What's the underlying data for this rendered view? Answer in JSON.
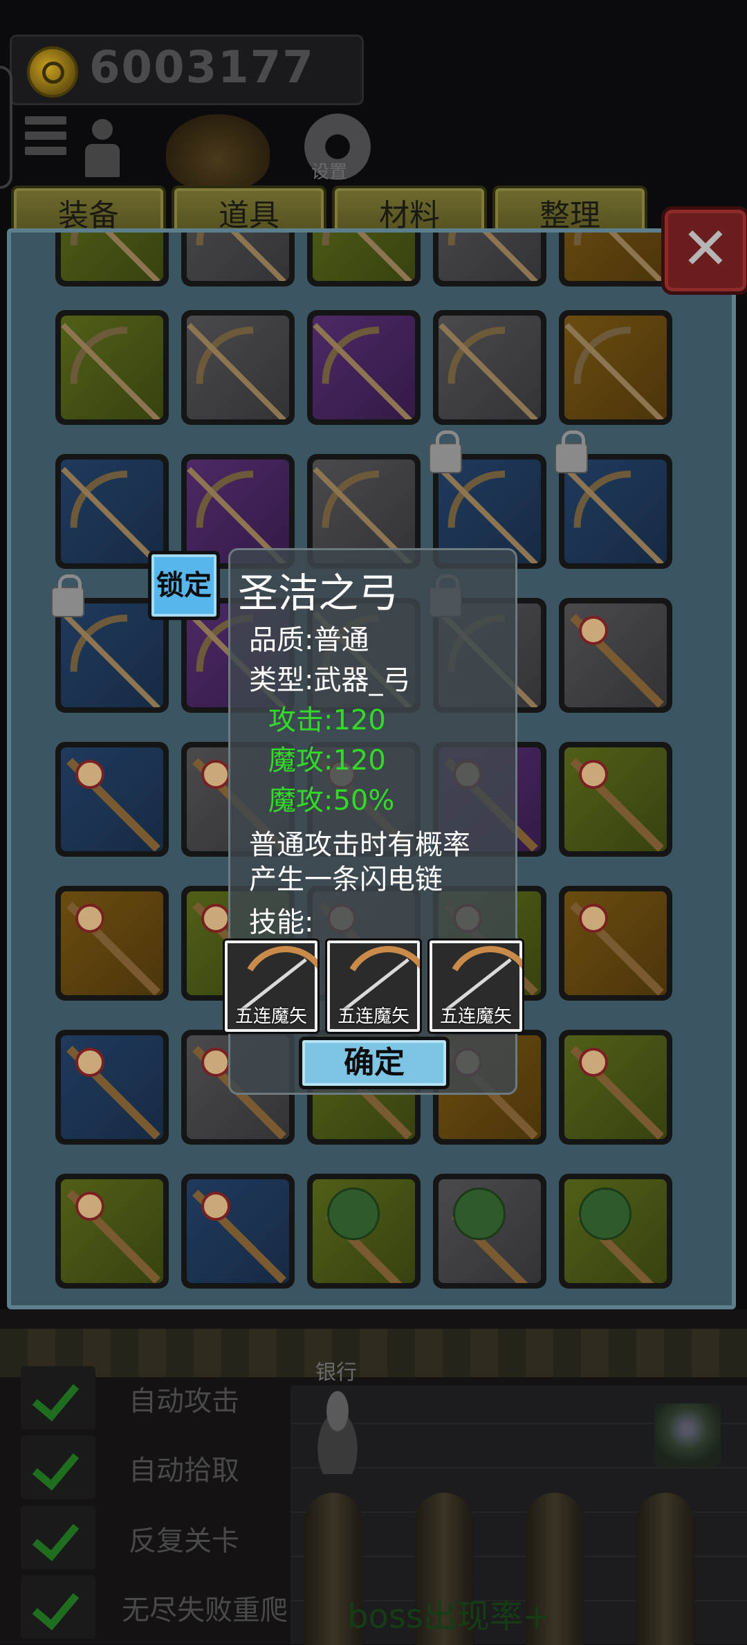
{
  "hud": {
    "gold": "6003177",
    "settings_label": "设置",
    "icons": [
      "coin-icon",
      "menu-icon",
      "pawn-icon",
      "bag-icon",
      "gear-icon"
    ]
  },
  "tabs": [
    "装备",
    "道具",
    "材料",
    "整理"
  ],
  "close_symbol": "✕",
  "inventory": {
    "rows": [
      [
        {
          "weapon": "bow",
          "quality": "green"
        },
        {
          "weapon": "bow",
          "quality": "gray"
        },
        {
          "weapon": "bow",
          "quality": "green"
        },
        {
          "weapon": "bow",
          "quality": "gray"
        },
        {
          "weapon": "bow",
          "quality": "orange"
        }
      ],
      [
        {
          "weapon": "bow",
          "quality": "green"
        },
        {
          "weapon": "bow",
          "quality": "gray"
        },
        {
          "weapon": "bow",
          "quality": "purple"
        },
        {
          "weapon": "bow",
          "quality": "gray"
        },
        {
          "weapon": "bow",
          "quality": "orange"
        }
      ],
      [
        {
          "weapon": "bow",
          "quality": "blue"
        },
        {
          "weapon": "bow",
          "quality": "purple"
        },
        {
          "weapon": "bow",
          "quality": "gray"
        },
        {
          "weapon": "bow",
          "quality": "blue",
          "locked": true
        },
        {
          "weapon": "bow",
          "quality": "blue",
          "locked": true
        }
      ],
      [
        {
          "weapon": "bow",
          "quality": "blue",
          "locked": true
        },
        {
          "weapon": "bow",
          "quality": "purple",
          "locked": true
        },
        {
          "weapon": "bow",
          "quality": "gray"
        },
        {
          "weapon": "bow",
          "quality": "gray",
          "locked": true
        },
        {
          "weapon": "staff",
          "quality": "gray"
        }
      ],
      [
        {
          "weapon": "staff",
          "quality": "blue"
        },
        {
          "weapon": "staff",
          "quality": "gray"
        },
        {
          "weapon": "staff",
          "quality": "gray"
        },
        {
          "weapon": "staff",
          "quality": "purple"
        },
        {
          "weapon": "staff",
          "quality": "green"
        }
      ],
      [
        {
          "weapon": "staff",
          "quality": "orange"
        },
        {
          "weapon": "staff",
          "quality": "green"
        },
        {
          "weapon": "staff",
          "quality": "gray"
        },
        {
          "weapon": "staff",
          "quality": "green"
        },
        {
          "weapon": "staff",
          "quality": "orange"
        }
      ],
      [
        {
          "weapon": "staff",
          "quality": "blue"
        },
        {
          "weapon": "staff",
          "quality": "gray"
        },
        {
          "weapon": "staff",
          "quality": "green"
        },
        {
          "weapon": "staff",
          "quality": "orange"
        },
        {
          "weapon": "staff",
          "quality": "green"
        }
      ],
      [
        {
          "weapon": "staff",
          "quality": "green"
        },
        {
          "weapon": "staff",
          "quality": "blue"
        },
        {
          "weapon": "club",
          "quality": "green"
        },
        {
          "weapon": "club",
          "quality": "gray"
        },
        {
          "weapon": "club",
          "quality": "green"
        }
      ]
    ]
  },
  "tooltip": {
    "lock_label": "锁定",
    "name": "圣洁之弓",
    "quality": "品质:普通",
    "type": "类型:武器_弓",
    "stats": [
      "攻击:120",
      "魔攻:120",
      "魔攻:50%"
    ],
    "effect_line1": "普通攻击时有概率",
    "effect_line2": "产生一条闪电链",
    "skills_label": "技能:",
    "skills": [
      "五连魔矢",
      "五连魔矢",
      "五连魔矢"
    ],
    "confirm_label": "确定"
  },
  "bottom": {
    "bank_label": "银行",
    "toggles": [
      "自动攻击",
      "自动拾取",
      "反复关卡",
      "无尽失败重爬"
    ],
    "boss_text": "boss出现率+"
  },
  "colors": {
    "panel": "#3c5562",
    "tab": "#6e6a2e",
    "stat_green": "#33d82b",
    "lock_blue": "#57b6ec",
    "confirm_blue": "#7ec4e4",
    "close_red": "#6b1e1e"
  }
}
